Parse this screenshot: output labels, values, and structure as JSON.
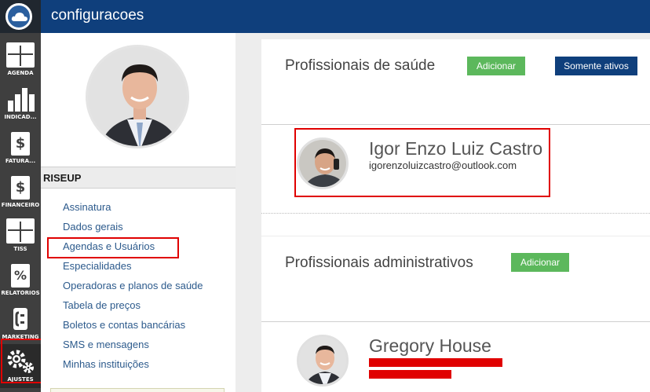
{
  "app": {
    "title": "configuracoes"
  },
  "rail": {
    "items": [
      {
        "label": "AGENDA",
        "icon": "calendar-book-icon"
      },
      {
        "label": "INDICAD...",
        "icon": "bar-chart-icon"
      },
      {
        "label": "FATURA...",
        "icon": "dollar-document-icon"
      },
      {
        "label": "FINANCEIRO",
        "icon": "dollar-document-icon"
      },
      {
        "label": "TISS",
        "icon": "tiss-book-icon"
      },
      {
        "label": "RELATÓRIOS",
        "icon": "percent-document-icon"
      },
      {
        "label": "MARKETING",
        "icon": "phone-icon"
      },
      {
        "label": "AJUSTES",
        "icon": "gears-icon"
      }
    ],
    "active": "AJUSTES"
  },
  "menu": {
    "section_title": "RISEUP",
    "items": [
      "Assinatura",
      "Dados gerais",
      "Agendas e Usuários",
      "Especialidades",
      "Operadoras e planos de saúde",
      "Tabela de preços",
      "Boletos e contas bancárias",
      "SMS e mensagens",
      "Minhas instituições"
    ],
    "highlighted": "Agendas e Usuários"
  },
  "health_professionals": {
    "title": "Profissionais de saúde",
    "add_label": "Adicionar",
    "active_only_label": "Somente ativos",
    "list": [
      {
        "name": "Igor Enzo Luiz Castro",
        "email": "igorenzoluizcastro@outlook.com"
      }
    ]
  },
  "admin_professionals": {
    "title": "Profissionais administrativos",
    "add_label": "Adicionar",
    "list": [
      {
        "name": "Gregory House"
      }
    ]
  },
  "colors": {
    "header": "#0f3f7c",
    "rail": "#3f3f3f",
    "green_button": "#5cb85c",
    "highlight": "#e00000",
    "link": "#2c5a8c"
  }
}
